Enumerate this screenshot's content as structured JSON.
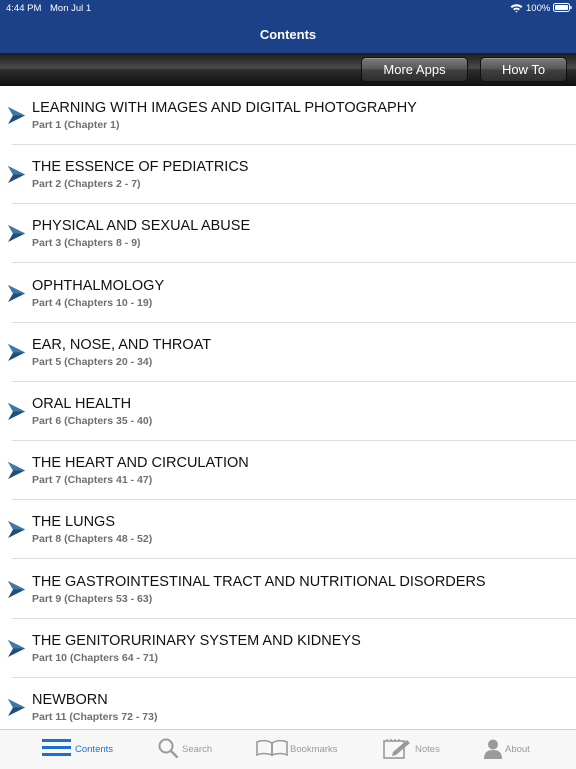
{
  "status_bar": {
    "time": "4:44 PM",
    "date": "Mon Jul 1",
    "battery": "100%"
  },
  "header": {
    "title": "Contents"
  },
  "toolbar": {
    "more_apps": "More Apps",
    "how_to": "How To"
  },
  "colors": {
    "nav_blue": "#1b4189",
    "arrow": "#1d4f7a",
    "active_tab": "#1c6fd1"
  },
  "contents": [
    {
      "title": "LEARNING WITH IMAGES AND DIGITAL PHOTOGRAPHY",
      "subtitle": "Part 1 (Chapter 1)"
    },
    {
      "title": "THE ESSENCE OF PEDIATRICS",
      "subtitle": "Part 2 (Chapters 2 - 7)"
    },
    {
      "title": "PHYSICAL AND SEXUAL ABUSE",
      "subtitle": "Part 3 (Chapters 8 - 9)"
    },
    {
      "title": "OPHTHALMOLOGY",
      "subtitle": "Part 4 (Chapters 10 - 19)"
    },
    {
      "title": "EAR, NOSE, AND THROAT",
      "subtitle": "Part 5 (Chapters 20 - 34)"
    },
    {
      "title": "ORAL HEALTH",
      "subtitle": "Part 6 (Chapters 35 - 40)"
    },
    {
      "title": "THE HEART AND CIRCULATION",
      "subtitle": "Part 7 (Chapters 41 - 47)"
    },
    {
      "title": "THE LUNGS",
      "subtitle": "Part 8 (Chapters 48 - 52)"
    },
    {
      "title": "THE GASTROINTESTINAL TRACT AND NUTRITIONAL DISORDERS",
      "subtitle": "Part 9 (Chapters 53 - 63)"
    },
    {
      "title": "THE GENITORURINARY SYSTEM AND KIDNEYS",
      "subtitle": "Part 10 (Chapters 64 - 71)"
    },
    {
      "title": "NEWBORN",
      "subtitle": "Part 11 (Chapters 72 - 73)"
    }
  ],
  "tabbar": [
    {
      "label": "Contents",
      "icon": "list-icon",
      "active": true
    },
    {
      "label": "Search",
      "icon": "search-icon",
      "active": false
    },
    {
      "label": "Bookmarks",
      "icon": "book-icon",
      "active": false
    },
    {
      "label": "Notes",
      "icon": "notes-icon",
      "active": false
    },
    {
      "label": "About",
      "icon": "person-icon",
      "active": false
    }
  ]
}
